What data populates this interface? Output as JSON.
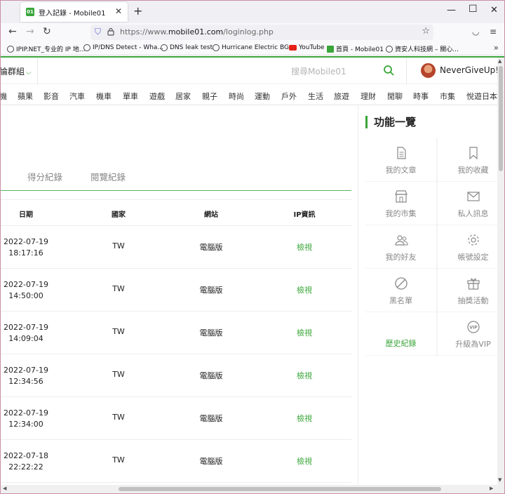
{
  "browser": {
    "tab_title": "登入記錄 - Mobile01",
    "favicon_text": "01",
    "url_prefix": "https://www.",
    "url_domain": "mobile01.com",
    "url_path": "/loginlog.php",
    "bookmarks": [
      "IPIP.NET_专业的 IP 地...",
      "IP/DNS Detect - Wha...",
      "DNS leak test",
      "Hurricane Electric BG...",
      "YouTube",
      "首頁 - Mobile01",
      "資安人科技網 – 關心..."
    ]
  },
  "header": {
    "forum_groups": "論群組",
    "search_placeholder": "搜尋Mobile01",
    "username": "NeverGiveUp!!"
  },
  "categories": [
    "機",
    "蘋果",
    "影音",
    "汽車",
    "機車",
    "單車",
    "遊戲",
    "居家",
    "親子",
    "時尚",
    "運動",
    "戶外",
    "生活",
    "旅遊",
    "理財",
    "閒聊",
    "時事",
    "市集",
    "悅遊日本"
  ],
  "subtabs": [
    "得分紀錄",
    "閱覽紀錄"
  ],
  "table": {
    "headers": [
      "日期",
      "國家",
      "網站",
      "IP資訊"
    ],
    "rows": [
      {
        "date": "2022-07-19",
        "time": "18:17:16",
        "country": "TW",
        "site": "電腦版",
        "ip": "檢視"
      },
      {
        "date": "2022-07-19",
        "time": "14:50:00",
        "country": "TW",
        "site": "電腦版",
        "ip": "檢視"
      },
      {
        "date": "2022-07-19",
        "time": "14:09:04",
        "country": "TW",
        "site": "電腦版",
        "ip": "檢視"
      },
      {
        "date": "2022-07-19",
        "time": "12:34:56",
        "country": "TW",
        "site": "電腦版",
        "ip": "檢視"
      },
      {
        "date": "2022-07-19",
        "time": "12:34:00",
        "country": "TW",
        "site": "電腦版",
        "ip": "檢視"
      },
      {
        "date": "2022-07-18",
        "time": "22:22:22",
        "country": "TW",
        "site": "電腦版",
        "ip": "檢視"
      }
    ]
  },
  "panel": {
    "title": "功能一覽",
    "items": [
      {
        "label": "我的文章",
        "icon": "document-icon"
      },
      {
        "label": "我的收藏",
        "icon": "bookmark-icon"
      },
      {
        "label": "我的市集",
        "icon": "store-icon"
      },
      {
        "label": "私人訊息",
        "icon": "mail-icon"
      },
      {
        "label": "我的好友",
        "icon": "friends-icon"
      },
      {
        "label": "帳號設定",
        "icon": "gear-icon"
      },
      {
        "label": "黑名單",
        "icon": "block-icon"
      },
      {
        "label": "抽獎活動",
        "icon": "gift-icon"
      },
      {
        "label": "歷史紀錄",
        "icon": "",
        "active": true
      },
      {
        "label": "升級為VIP",
        "icon": "vip-icon"
      }
    ]
  },
  "colors": {
    "accent": "#3aa53a",
    "muted": "#888888"
  }
}
